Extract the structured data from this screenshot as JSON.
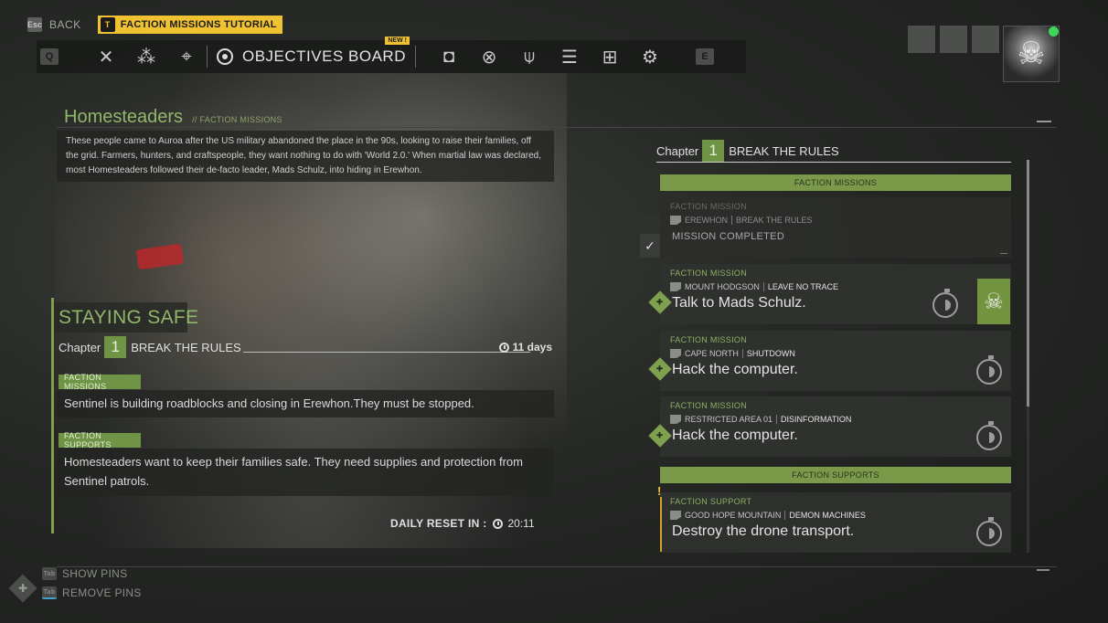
{
  "top": {
    "back_key": "Esc",
    "back_label": "BACK",
    "tutorial_key": "T",
    "tutorial_label": "FACTION MISSIONS TUTORIAL"
  },
  "nav": {
    "left_key": "Q",
    "right_key": "E",
    "active_tab": "OBJECTIVES BOARD",
    "new_badge": "NEW !",
    "icons_left": [
      "crossed-tools-icon",
      "squad-icon",
      "map-pin-icon"
    ],
    "icons_right": [
      "backpack-icon",
      "chevron-badge-icon",
      "outfit-icon",
      "skills-icon",
      "vehicle-icon",
      "gear-icon"
    ]
  },
  "faction": {
    "name": "Homesteaders",
    "subtitle": "// FACTION MISSIONS",
    "description": "These people came to Auroa after the US military abandoned the place in the 90s, looking to raise their families, off the grid. Farmers, hunters, and craftspeople, they want nothing to do with 'World 2.0.' When martial law was declared, most Homesteaders followed their de-facto leader, Mads Schulz, into hiding in Erewhon."
  },
  "left_panel": {
    "title": "STAYING SAFE",
    "chapter_word": "Chapter",
    "chapter_num": "1",
    "chapter_name": "BREAK THE RULES",
    "time_left": "11 days",
    "missions_tag": "FACTION MISSIONS",
    "missions_text": "Sentinel is building roadblocks and closing in Erewhon.They must be stopped.",
    "supports_tag": "FACTION SUPPORTS",
    "supports_text": "Homesteaders want to keep their families safe. They need supplies and protection from Sentinel patrols.",
    "daily_reset_label": "DAILY RESET IN :",
    "daily_reset_time": "20:11"
  },
  "right_panel": {
    "chapter_word": "Chapter",
    "chapter_num": "1",
    "chapter_name": "BREAK THE RULES",
    "section_missions": "FACTION MISSIONS",
    "section_supports": "FACTION SUPPORTS",
    "cards": [
      {
        "type": "FACTION MISSION",
        "location": "EREWHON",
        "mission": "BREAK THE RULES",
        "objective": "MISSION COMPLETED"
      },
      {
        "type": "FACTION MISSION",
        "location": "MOUNT HODGSON",
        "mission": "LEAVE NO TRACE",
        "objective": "Talk to Mads Schulz."
      },
      {
        "type": "FACTION MISSION",
        "location": "CAPE NORTH",
        "mission": "SHUTDOWN",
        "objective": "Hack the computer."
      },
      {
        "type": "FACTION MISSION",
        "location": "RESTRICTED AREA 01",
        "mission": "DISINFORMATION",
        "objective": "Hack the computer."
      },
      {
        "type": "FACTION SUPPORT",
        "location": "GOOD HOPE MOUNTAIN",
        "mission": "DEMON MACHINES",
        "objective": "Destroy the drone transport."
      }
    ]
  },
  "bottom": {
    "show_pins_key": "Tab",
    "show_pins": "SHOW PINS",
    "remove_pins_key": "Tab",
    "remove_pins": "REMOVE PINS"
  },
  "colors": {
    "accent_green": "#7ea04f",
    "title_green": "#92b66a",
    "gold": "#f0c232",
    "online": "#3fd45a"
  }
}
